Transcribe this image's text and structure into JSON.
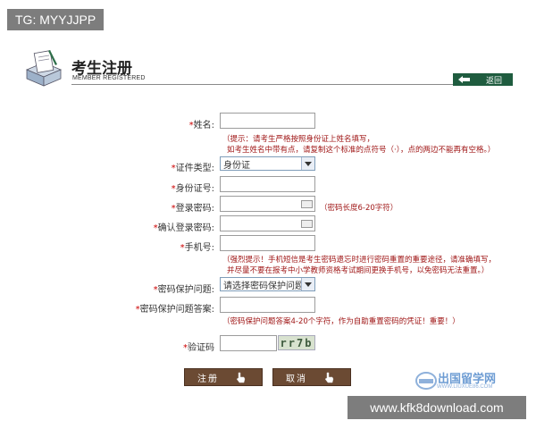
{
  "watermark_top": "TG: MYYJJPP",
  "header": {
    "title": "考生注册",
    "subtitle": "MEMBER REGISTERED",
    "back_label": "返回"
  },
  "form": {
    "required_mark": "*",
    "name_label": "姓名:",
    "name_hint_line1": "（提示：请考生严格按照身份证上姓名填写，",
    "name_hint_line2": "如考生姓名中带有点，请复制这个标准的点符号（·），点的两边不能再有空格。）",
    "id_type_label": "证件类型:",
    "id_type_value": "身份证",
    "id_number_label": "身份证号:",
    "password_label": "登录密码:",
    "password_hint": "（密码长度6-20字符）",
    "confirm_password_label": "确认登录密码:",
    "phone_label": "手机号:",
    "phone_hint_line1": "（强烈提示！手机短信是考生密码遗忘时进行密码重置的重要途径，请准确填写，",
    "phone_hint_line2": "并尽量不要在报考中小学教师资格考试期间更换手机号，以免密码无法重置。）",
    "security_question_label": "密码保护问题:",
    "security_question_value": "请选择密码保护问题",
    "security_answer_label": "密码保护问题答案:",
    "security_answer_hint": "（密码保护问题答案4-20个字符，作为自助重置密码的凭证！重要！）",
    "captcha_label": "验证码",
    "captcha_text": "rr7b"
  },
  "buttons": {
    "register": "注册",
    "cancel": "取消"
  },
  "watermark_logo": {
    "text": "出国留学网",
    "url": "WWW.LIUXUE86.COM"
  },
  "watermark_bottom": "www.kfk8download.com",
  "colors": {
    "hint": "#a01818",
    "required": "#cc0000",
    "button": "#6b4a33",
    "back_button": "#1f5c3f"
  }
}
